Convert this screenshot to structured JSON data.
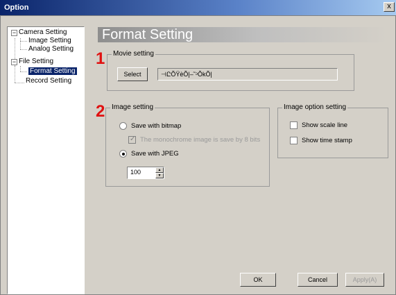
{
  "window": {
    "title": "Option",
    "close_label": "x"
  },
  "tree": {
    "camera_setting": "Camera Setting",
    "image_setting": "Image Setting",
    "analog_setting": "Analog Setting",
    "file_setting": "File Setting",
    "format_setting": "Format Setting",
    "record_setting": "Record Setting",
    "collapse_symbol": "−"
  },
  "header": {
    "title": "Format Setting"
  },
  "markers": {
    "first": "1",
    "second": "2"
  },
  "movie": {
    "legend": "Movie setting",
    "select_label": "Select",
    "path_value": "⊣ԸÕŸèÕ|–˜ᵓÕkÕ|"
  },
  "image": {
    "legend": "Image setting",
    "bitmap_label": "Save with bitmap",
    "monochrome_label": "The monochrome image is save by 8 bits",
    "jpeg_label": "Save with JPEG",
    "quality_value": "100"
  },
  "option": {
    "legend": "Image option setting",
    "scale_line_label": "Show scale line",
    "time_stamp_label": "Show time stamp"
  },
  "buttons": {
    "ok": "OK",
    "cancel": "Cancel",
    "apply": "Apply(A)"
  }
}
